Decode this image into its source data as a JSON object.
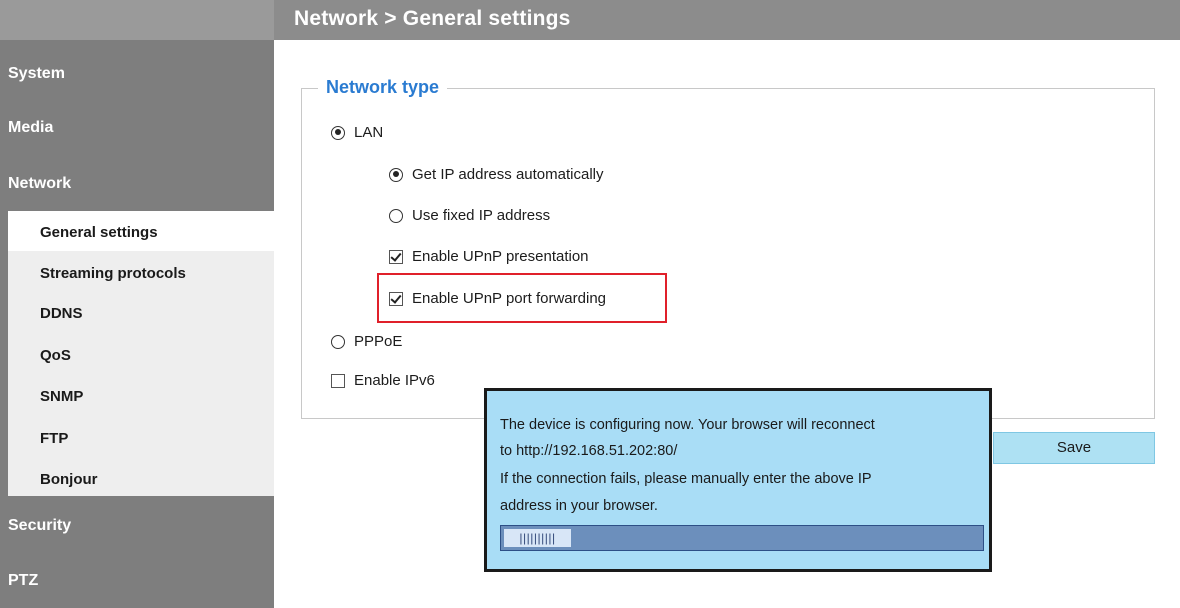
{
  "header": {
    "title": "Network  > General settings"
  },
  "sidebar": {
    "categories": [
      {
        "label": "System"
      },
      {
        "label": "Media"
      },
      {
        "label": "Network"
      },
      {
        "label": "Security"
      },
      {
        "label": "PTZ"
      }
    ],
    "network_items": [
      {
        "label": "General settings",
        "active": true
      },
      {
        "label": "Streaming protocols"
      },
      {
        "label": "DDNS"
      },
      {
        "label": "QoS"
      },
      {
        "label": "SNMP"
      },
      {
        "label": "FTP"
      },
      {
        "label": "Bonjour"
      }
    ]
  },
  "main": {
    "section_title": "Network type",
    "options": {
      "lan": {
        "label": "LAN",
        "selected": true
      },
      "auto_ip": {
        "label": "Get IP address automatically",
        "selected": true
      },
      "fixed_ip": {
        "label": "Use fixed IP address",
        "selected": false
      },
      "upnp_presentation": {
        "label": "Enable UPnP presentation",
        "checked": true
      },
      "upnp_port_forwarding": {
        "label": "Enable UPnP port forwarding",
        "checked": true
      },
      "pppoe": {
        "label": "PPPoE",
        "selected": false
      },
      "ipv6": {
        "label": "Enable IPv6",
        "checked": false
      }
    },
    "save_label": "Save",
    "highlight_color": "#e0202a"
  },
  "dialog": {
    "lines": [
      "The device is configuring now. Your browser will reconnect",
      "to http://192.168.51.202:80/",
      "If the connection fails, please manually enter the above IP",
      "address in your browser."
    ],
    "progress_fraction": 0.14,
    "progress_text": "||||||||||"
  },
  "colors": {
    "sidebar": "#7e7e7e",
    "header": "#8c8c8c",
    "legend": "#2a7bd1",
    "dialog_bg": "#a9ddf6",
    "save_bg": "#aee1f3"
  }
}
